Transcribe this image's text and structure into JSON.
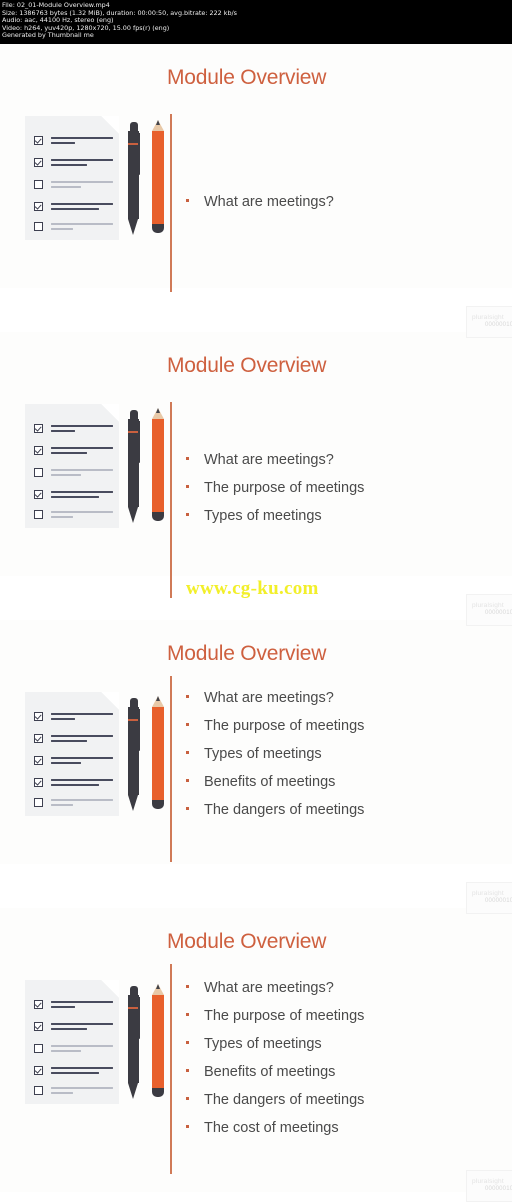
{
  "meta_header": {
    "lines": [
      "File: 02_01-Module Overview.mp4",
      "Size: 1386763 bytes (1.32 MiB), duration: 00:00:50, avg.bitrate: 222 kb/s",
      "Audio: aac, 44100 Hz, stereo (eng)",
      "Video: h264, yuv420p, 1280x720, 15.00 fps(r) (eng)",
      "Generated by Thumbnail me"
    ]
  },
  "colors": {
    "accent_orange": "#CE603F",
    "rule_orange": "#D07A57",
    "pencil_orange": "#E8602C",
    "pen_dark": "#3B3B42",
    "bullet_text": "#4A4A4A",
    "watermark_yellow": "#F2EF2A",
    "slide_bg": "#FDFDFC"
  },
  "slides": [
    {
      "title": "Module Overview",
      "bullets": [
        "What are meetings?"
      ],
      "checkboxes": [
        true,
        true,
        false,
        true,
        false
      ]
    },
    {
      "title": "Module Overview",
      "bullets": [
        "What are meetings?",
        "The purpose of meetings",
        "Types of meetings"
      ],
      "checkboxes": [
        true,
        true,
        false,
        true,
        false
      ]
    },
    {
      "title": "Module Overview",
      "bullets": [
        "What are meetings?",
        "The purpose of meetings",
        "Types of meetings",
        "Benefits of meetings",
        "The dangers of meetings"
      ],
      "checkboxes": [
        true,
        true,
        true,
        true,
        false
      ]
    },
    {
      "title": "Module Overview",
      "bullets": [
        "What are meetings?",
        "The purpose of meetings",
        "Types of meetings",
        "Benefits of meetings",
        "The dangers of meetings",
        "The cost of meetings"
      ],
      "checkboxes": [
        true,
        true,
        false,
        true,
        false
      ]
    }
  ],
  "watermarks": {
    "site": "www.cg-ku.com",
    "brand_name": "pluralsight",
    "brand_sub": "00000010"
  }
}
